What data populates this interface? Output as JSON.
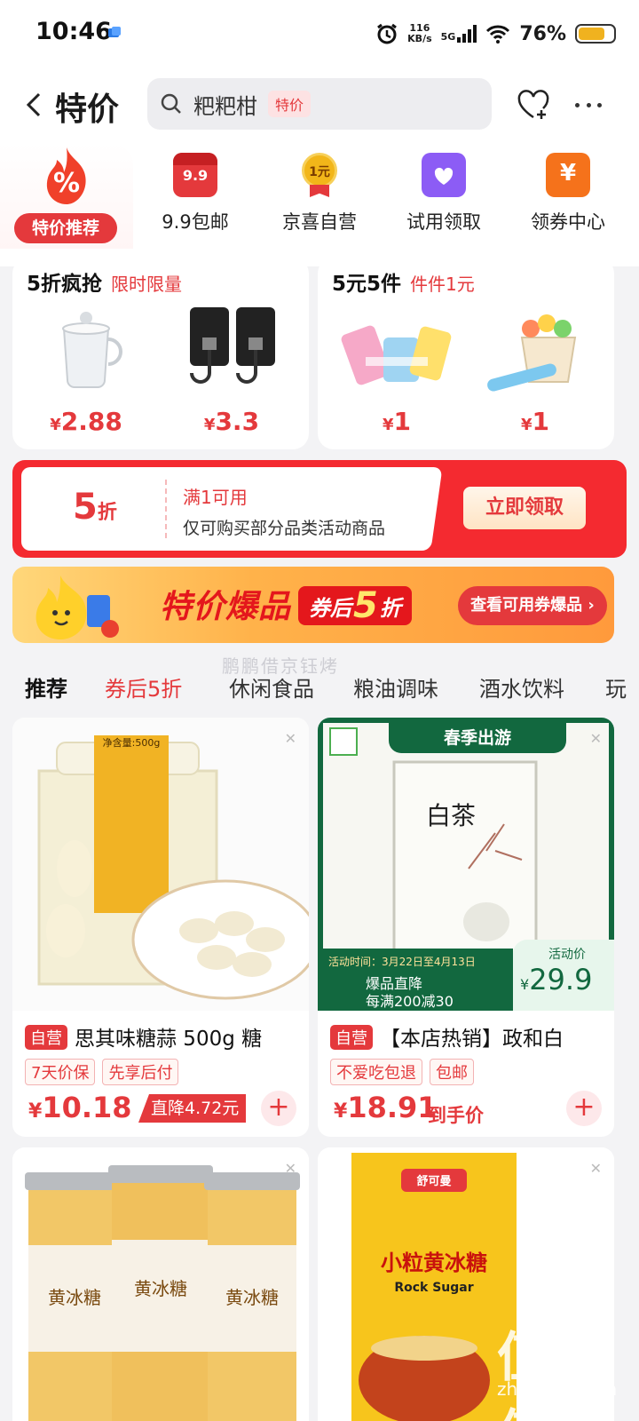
{
  "status": {
    "time": "10:46",
    "net_speed_value": "116",
    "net_speed_unit": "KB/s",
    "network": "5G",
    "battery": "76%"
  },
  "header": {
    "title": "特价",
    "search_text": "粑粑柑",
    "search_tag": "特价"
  },
  "categories": [
    {
      "label": "特价推荐",
      "active": true
    },
    {
      "label": "9.9包邮",
      "icon_text": "9.9",
      "color": "#e4393c"
    },
    {
      "label": "京喜自营",
      "icon_text": "1元",
      "color": "#f2b619"
    },
    {
      "label": "试用领取",
      "color": "#8c5cf5"
    },
    {
      "label": "领券中心",
      "icon_text": "¥",
      "color": "#f5721b"
    }
  ],
  "deals": [
    {
      "title": "5折疯抢",
      "subtitle": "限时限量",
      "items": [
        {
          "currency": "¥",
          "price": "2.88",
          "icon": "glass-cup-image"
        },
        {
          "currency": "¥",
          "price": "3.3",
          "icon": "wall-hooks-image"
        }
      ]
    },
    {
      "title": "5元5件",
      "subtitle": "件件1元",
      "items": [
        {
          "currency": "¥",
          "price": "1",
          "icon": "puzzle-cube-image"
        },
        {
          "currency": "¥",
          "price": "1",
          "icon": "fruit-picks-image"
        }
      ]
    }
  ],
  "coupon": {
    "discount": "5",
    "discount_unit": "折",
    "condition": "满1可用",
    "description": "仅可购买部分品类活动商品",
    "button": "立即领取"
  },
  "banner": {
    "title": "特价爆品",
    "tag_a": "券后",
    "tag_b": "5",
    "tag_c": "折",
    "button": "查看可用券爆品 ›"
  },
  "watermark": "鹏鹏借京钰烤",
  "tabs": [
    "推荐",
    "券后5折",
    "休闲食品",
    "粮油调味",
    "酒水饮料",
    "玩"
  ],
  "products": [
    {
      "badge": "自营",
      "title": "思其味糖蒜 500g 糖",
      "tags": [
        "7天价保",
        "先享后付"
      ],
      "currency": "¥",
      "price": "10.18",
      "drop": "直降4.72元",
      "image_text": "净含量:500g"
    },
    {
      "badge": "自营",
      "title": "【本店热销】政和白",
      "tags": [
        "不爱吃包退",
        "包邮"
      ],
      "currency": "¥",
      "price": "18.91",
      "price_note": "到手价",
      "promo_top": "春季出游",
      "activity_time": "活动时间：3月22日至4月13日",
      "activity_line1": "爆品直降",
      "activity_line2": "每满200减30",
      "activity_label": "活动价",
      "activity_currency": "¥",
      "activity_price": "29.9",
      "image_text": "白茶"
    },
    {
      "image_text": "黄冰糖"
    },
    {
      "image_brand": "舒可曼",
      "image_text": "小粒黄冰糖",
      "image_text_en": "Rock Sugar"
    }
  ],
  "site_mark": "值值值",
  "site_url": "zhizhizhi.com",
  "colors": {
    "brand": "#e4393c",
    "green": "#12683f"
  }
}
